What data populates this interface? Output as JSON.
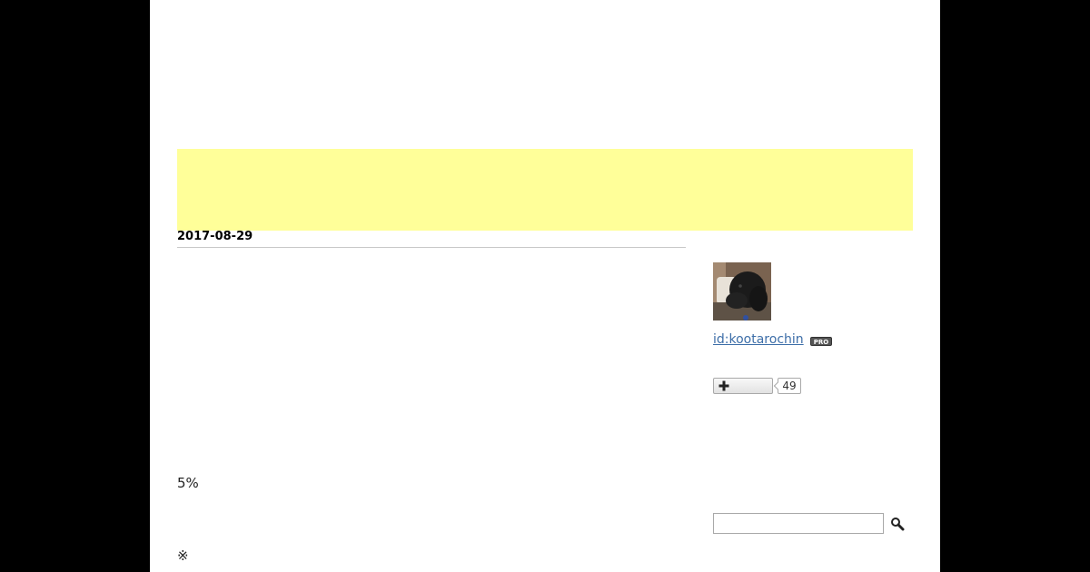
{
  "entry": {
    "date": "2017-08-29",
    "percent_text": "5%",
    "note_mark": "※"
  },
  "sidebar": {
    "profile": {
      "user_id": "id:kootarochin",
      "badge": "PRO"
    },
    "follow": {
      "icon": "plus-icon",
      "count": "49"
    },
    "search": {
      "placeholder": "",
      "icon": "search-icon"
    }
  },
  "colors": {
    "banner": "#ffff99",
    "link": "#3d6ea8",
    "page_bg": "#ffffff",
    "outer_bg": "#000000"
  }
}
